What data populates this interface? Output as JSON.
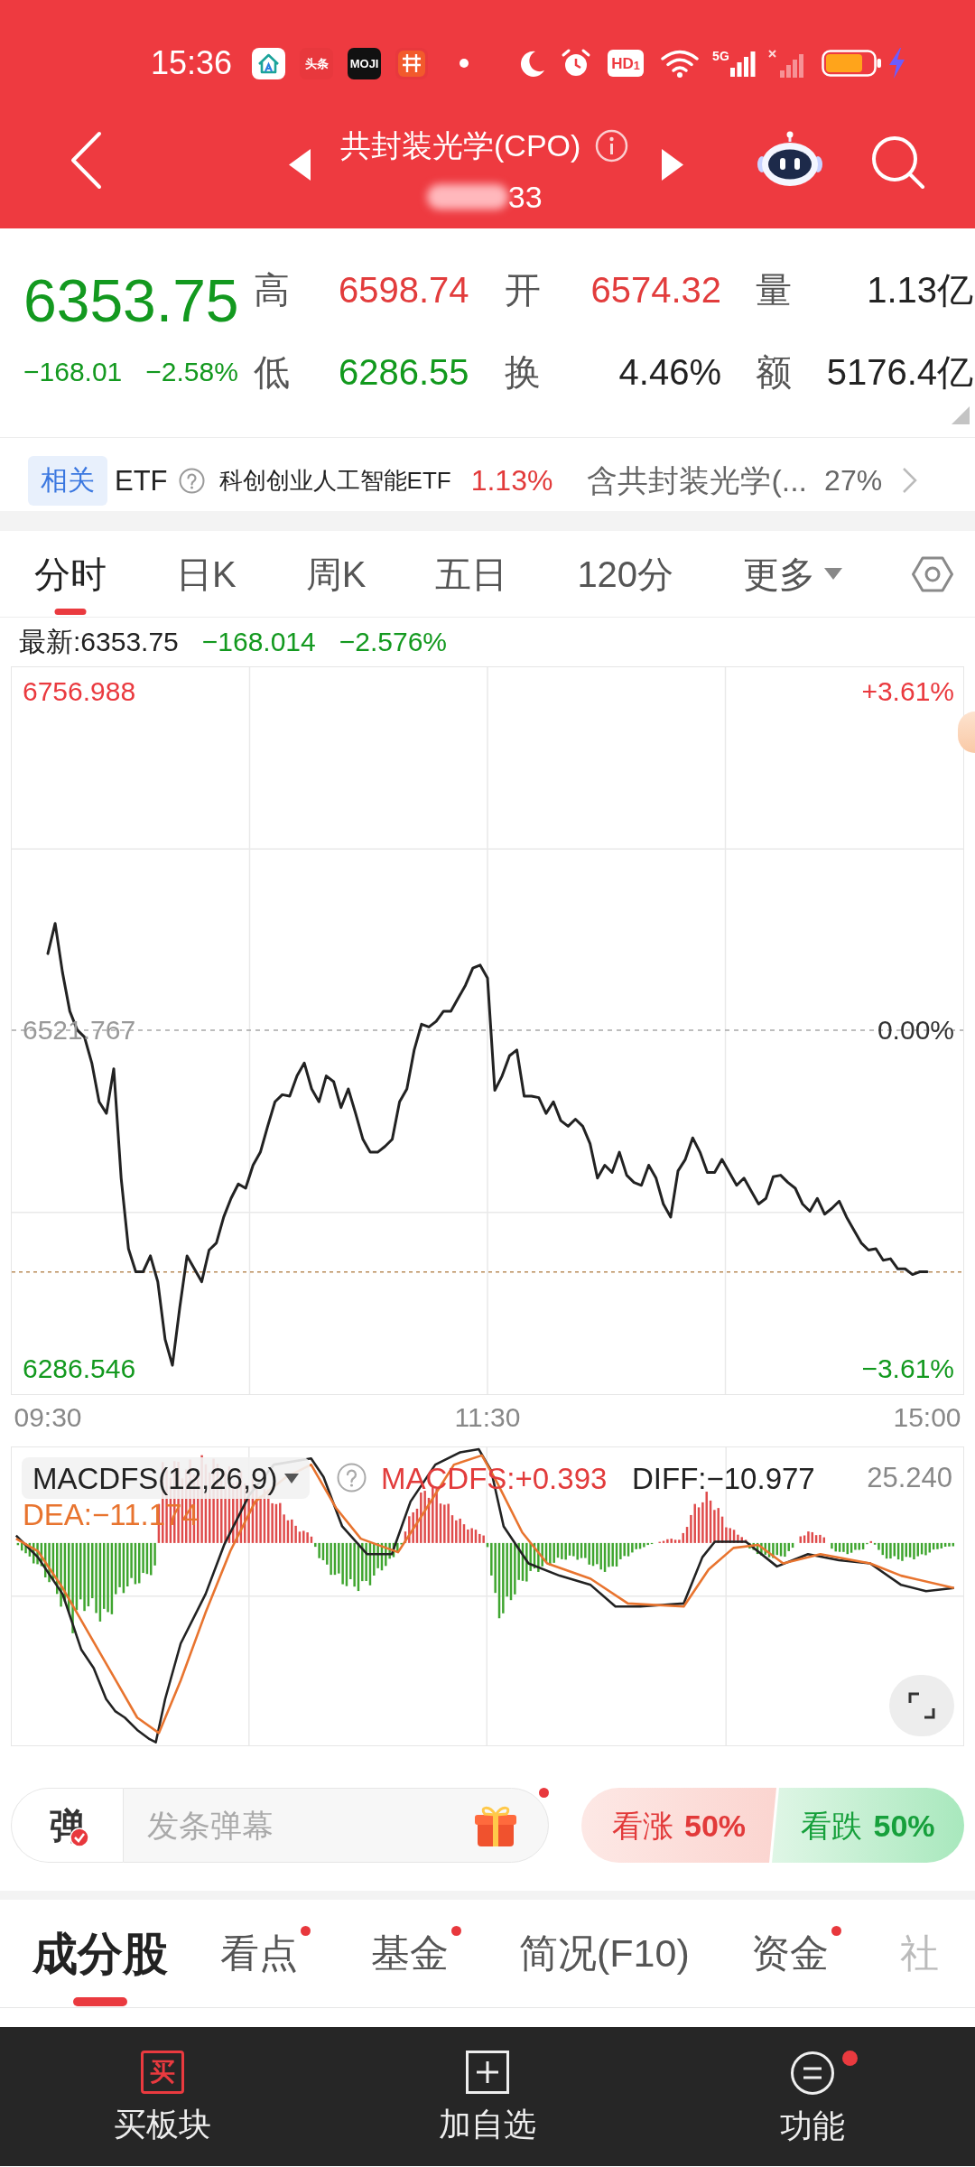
{
  "status_bar": {
    "time": "15:36",
    "notifications": [
      {
        "kind": "house"
      },
      {
        "kind": "label",
        "label": "头条",
        "color": "#e8383d"
      },
      {
        "kind": "label",
        "label": "MOJI",
        "color": "#111111"
      },
      {
        "kind": "tile"
      }
    ],
    "hd_badge": "HD$_{1}$",
    "network": "5G",
    "charging": true
  },
  "header": {
    "title": "共封装光学(CPO)",
    "code": "33"
  },
  "quote": {
    "falling": true,
    "price": "6353.75",
    "change": "−168.01",
    "change_pct": "−2.58%",
    "stats": [
      {
        "label": "高",
        "value": "6598.74",
        "color": "#e23c3c"
      },
      {
        "label": "开",
        "value": "6574.32",
        "color": "#e23c3c"
      },
      {
        "label": "量",
        "value": "1.13亿",
        "color": "#222222"
      },
      {
        "label": "低",
        "value": "6286.55",
        "color": "#12991d"
      },
      {
        "label": "换",
        "value": "4.46%",
        "color": "#222222"
      },
      {
        "label": "额",
        "value": "5176.4亿",
        "color": "#222222"
      }
    ]
  },
  "related_etf": {
    "badge": "相关",
    "label": "ETF",
    "name": "科创创业人工智能ETF",
    "change": "1.13%",
    "holding": "含共封装光学(...",
    "weight": "27%"
  },
  "chart_tabs": [
    {
      "kind": "tab",
      "label": "分时",
      "selected": true
    },
    {
      "kind": "tab",
      "label": "日K",
      "selected": false
    },
    {
      "kind": "tab",
      "label": "周K",
      "selected": false
    },
    {
      "kind": "tab",
      "label": "五日",
      "selected": false
    },
    {
      "kind": "tab",
      "label": "120分",
      "selected": false
    },
    {
      "kind": "menu",
      "label": "更多",
      "selected": false
    }
  ],
  "latest": {
    "label": "最新:6353.75",
    "change": "−168.014",
    "change_pct": "−2.576%"
  },
  "intraday_chart": {
    "chart_data": {
      "type": "line",
      "categories": [
        "09:30",
        null,
        null,
        null,
        null,
        null,
        null,
        null,
        null,
        null,
        null,
        null,
        null,
        null,
        null,
        null,
        null,
        null,
        null,
        null,
        null,
        null,
        null,
        null,
        null,
        null,
        null,
        null,
        null,
        null,
        null,
        null,
        null,
        null,
        null,
        null,
        null,
        null,
        null,
        null,
        null,
        null,
        null,
        null,
        null,
        null,
        null,
        null,
        null,
        null,
        null,
        null,
        null,
        null,
        null,
        null,
        null,
        null,
        null,
        null,
        "11:30",
        null,
        null,
        null,
        null,
        null,
        null,
        null,
        null,
        null,
        null,
        null,
        null,
        null,
        null,
        null,
        null,
        null,
        null,
        null,
        null,
        null,
        null,
        null,
        null,
        null,
        null,
        null,
        null,
        null,
        null,
        null,
        null,
        null,
        null,
        null,
        null,
        null,
        null,
        null,
        null,
        null,
        null,
        null,
        null,
        null,
        null,
        null,
        null,
        null,
        null,
        null,
        null,
        null,
        null,
        null,
        null,
        null,
        null,
        null,
        "15:00"
      ],
      "values": [
        6575,
        6596,
        6562,
        6535,
        6522,
        6517,
        6499,
        6472,
        6464,
        6495,
        6419,
        6370,
        6354,
        6354,
        6365,
        6347,
        6307,
        6289,
        6329,
        6365,
        6356,
        6347,
        6369,
        6374,
        6392,
        6405,
        6415,
        6412,
        6428,
        6437,
        6455,
        6472,
        6477,
        6476,
        6490,
        6499,
        6481,
        6472,
        6490,
        6486,
        6468,
        6481,
        6464,
        6446,
        6437,
        6437,
        6441,
        6446,
        6472,
        6481,
        6508,
        6526,
        6524,
        6528,
        6535,
        6535,
        6544,
        6553,
        6565,
        6567,
        6558,
        6480,
        6490,
        6504,
        6508,
        6476,
        6476,
        6475,
        6464,
        6472,
        6459,
        6455,
        6460,
        6455,
        6443,
        6419,
        6428,
        6423,
        6437,
        6421,
        6416,
        6414,
        6428,
        6419,
        6401,
        6392,
        6424,
        6432,
        6447,
        6437,
        6423,
        6423,
        6432,
        6423,
        6414,
        6419,
        6410,
        6401,
        6405,
        6420,
        6421,
        6416,
        6412,
        6401,
        6396,
        6405,
        6394,
        6398,
        6403,
        6392,
        6383,
        6374,
        6369,
        6370,
        6362,
        6363,
        6356,
        6356,
        6352,
        6354,
        6354
      ],
      "ylim": [
        6268.982,
        6773.924
      ],
      "yticks": [
        {
          "value": 6756.988,
          "label": "6756.988"
        },
        {
          "value": 6521.767,
          "label": "6521.767"
        },
        {
          "value": 6286.546,
          "label": "6286.546"
        }
      ],
      "ref_lines": [
        {
          "axis": "y",
          "value": 6521.767
        },
        {
          "axis": "y",
          "value": 6353.75
        }
      ]
    },
    "percent_labels": [
      "+3.61%",
      "0.00%",
      "−3.61%"
    ]
  },
  "macd_panel": {
    "indicator": "MACDFS(12,26,9)",
    "readings": [
      {
        "label": "MACDFS:+0.393",
        "color": "#e23c3c"
      },
      {
        "label": "DIFF:−10.977",
        "color": "#222222"
      },
      {
        "label": "DEA:−11.174",
        "color": "#e8742f"
      }
    ],
    "scale": "25.240"
  },
  "danmaku": {
    "badge": "弹",
    "placeholder": "发条弹幕",
    "notified": true
  },
  "sentiment": [
    {
      "kind": "bull",
      "label": "看涨",
      "share": "50%"
    },
    {
      "kind": "bear",
      "label": "看跌",
      "share": "50%"
    }
  ],
  "info_tabs": [
    {
      "label": "成分股",
      "selected": true,
      "unread": false
    },
    {
      "label": "看点",
      "selected": false,
      "unread": true
    },
    {
      "label": "基金",
      "selected": false,
      "unread": true
    },
    {
      "label": "简况(F10)",
      "selected": false,
      "unread": false
    },
    {
      "label": "资金",
      "selected": false,
      "unread": true
    },
    {
      "label": "社",
      "selected": false,
      "unread": false
    }
  ],
  "bottom_nav": [
    {
      "kind": "buy",
      "icon_text": "买",
      "label": "买板块",
      "unread": false
    },
    {
      "kind": "add",
      "label": "加自选",
      "unread": false
    },
    {
      "kind": "menu",
      "label": "功能",
      "unread": true
    }
  ]
}
